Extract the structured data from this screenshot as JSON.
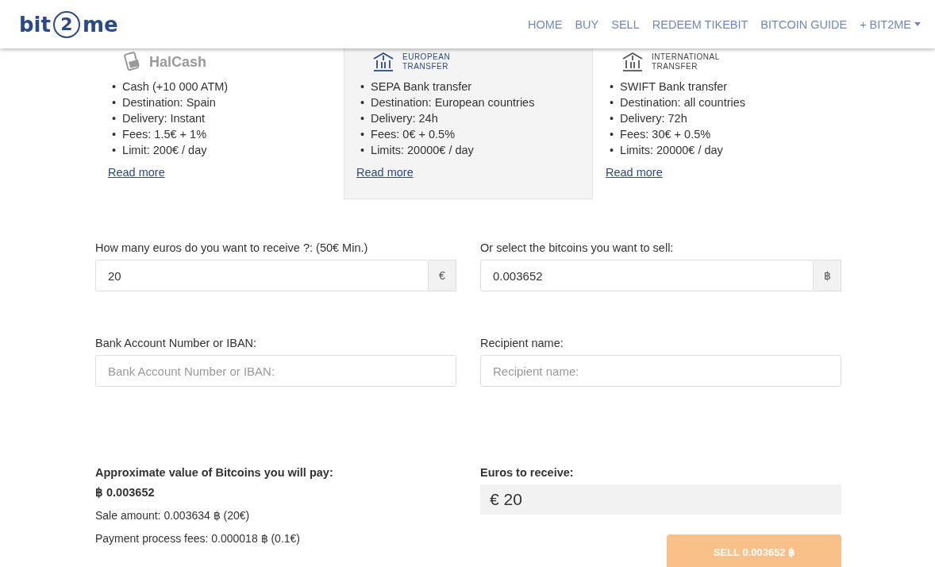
{
  "header": {
    "logo": {
      "left": "bit",
      "middle": "2",
      "right": "me"
    },
    "nav": [
      {
        "label": "HOME",
        "dropdown": false
      },
      {
        "label": "BUY",
        "dropdown": false
      },
      {
        "label": "SELL",
        "dropdown": false
      },
      {
        "label": "REDEEM TIKEBIT",
        "dropdown": false
      },
      {
        "label": "BITCOIN GUIDE",
        "dropdown": false
      },
      {
        "label": "+ BIT2ME",
        "dropdown": true
      }
    ]
  },
  "methods": [
    {
      "kind": "halcash",
      "selected": false,
      "bullet": "•",
      "logo_text": [
        "HalCash"
      ],
      "features": [
        "Cash (+10 000 ATM)",
        "Destination: Spain",
        "Delivery: Instant",
        "Fees: 1.5€ + 1%",
        "Limit: 200€ / day"
      ],
      "link": "Read more"
    },
    {
      "kind": "bank",
      "selected": true,
      "bullet": "•",
      "logo_text": [
        "EUROPEAN",
        "TRANSFER"
      ],
      "features": [
        "SEPA Bank transfer",
        "Destination: European countries",
        "Delivery: 24h",
        "Fees: 0€ + 0.5%",
        "Limits: 20000€ / day"
      ],
      "link": "Read more"
    },
    {
      "kind": "bank",
      "selected": false,
      "bullet": "•",
      "logo_text": [
        "INTERNATIONAL",
        "TRANSFER"
      ],
      "features": [
        "SWIFT Bank transfer",
        "Destination: all countries",
        "Delivery: 72h",
        "Fees: 30€ + 0.5%",
        "Limits: 20000€ / day"
      ],
      "link": "Read more"
    }
  ],
  "form": {
    "amount": {
      "label": "How many euros do you want to receive ?: (50€ Min.)",
      "value": "20",
      "addon": "€"
    },
    "bitcoins": {
      "label": "Or select the bitcoins you want to sell:",
      "value": "0.003652",
      "addon": "฿"
    },
    "iban": {
      "label": "Bank Account Number or IBAN:",
      "placeholder": "Bank Account Number or IBAN:"
    },
    "recipient": {
      "label": "Recipient name:",
      "placeholder": "Recipient name:"
    }
  },
  "summary": {
    "title": "Approximate value of Bitcoins you will pay:",
    "btc_value": "฿ 0.003652",
    "sale_amount": "Sale amount: 0.003634 ฿ (20€)",
    "fees": "Payment process fees: 0.000018 ฿ (0.1€)"
  },
  "receive": {
    "label": "Euros to receive:",
    "value": "€ 20"
  },
  "sell_button": "SELL 0.003652 ฿"
}
